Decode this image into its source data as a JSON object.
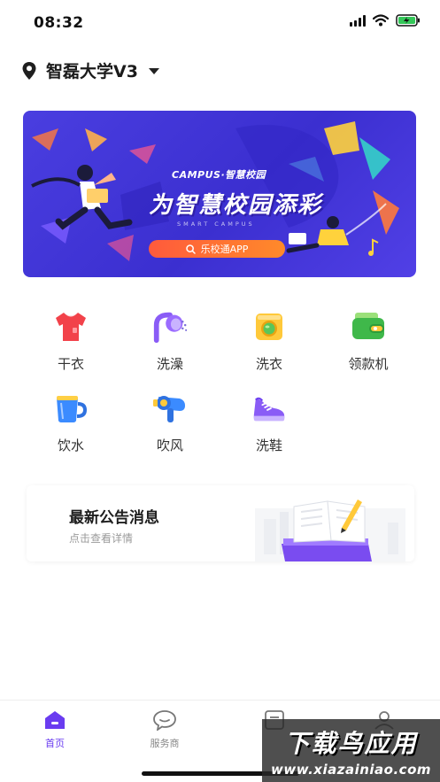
{
  "status_bar": {
    "time": "08:32",
    "icons": [
      "signal-icon",
      "wifi-icon",
      "battery-charging-icon"
    ]
  },
  "header": {
    "location_icon": "map-pin-icon",
    "campus": "智磊大学V3",
    "dropdown_icon": "caret-down-icon"
  },
  "banner": {
    "brand": "CAMPUS·智慧校园",
    "title": "为智慧校园添彩",
    "subtitle": "SMART CAMPUS",
    "search_label": "乐校通APP",
    "colors": {
      "background": "#4235dc",
      "pill": "#ff6a34",
      "accent_yellow": "#ffd23c"
    }
  },
  "services": [
    {
      "label": "干衣",
      "icon": "shirt-icon"
    },
    {
      "label": "洗澡",
      "icon": "shower-icon"
    },
    {
      "label": "洗衣",
      "icon": "washing-machine-icon"
    },
    {
      "label": "领款机",
      "icon": "wallet-icon"
    },
    {
      "label": "饮水",
      "icon": "cup-icon"
    },
    {
      "label": "吹风",
      "icon": "hair-dryer-icon"
    },
    {
      "label": "洗鞋",
      "icon": "sneaker-icon"
    }
  ],
  "notice": {
    "title": "最新公告消息",
    "subtitle": "点击查看详情",
    "art": "book-icon"
  },
  "tabbar": {
    "active_color": "#6a3cf0",
    "tabs": [
      {
        "label": "首页",
        "icon": "home-icon",
        "active": true
      },
      {
        "label": "服务商",
        "icon": "chat-icon",
        "active": false
      },
      {
        "label": "",
        "icon": "document-icon",
        "active": false
      },
      {
        "label": "",
        "icon": "user-icon",
        "active": false
      }
    ]
  },
  "watermark": {
    "cn": "下载鸟应用",
    "en": "www.xiazainiao.com"
  }
}
